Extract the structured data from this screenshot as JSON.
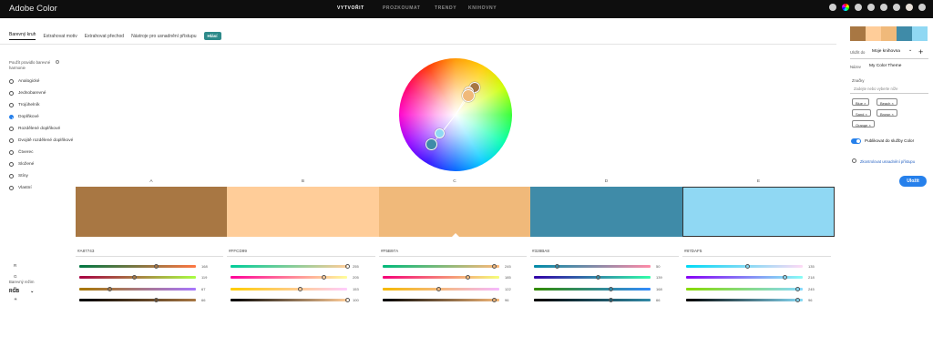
{
  "app_title": "Adobe Color",
  "topnav": [
    "VYTVOŘIT",
    "PROZKOUMAT",
    "TRENDY",
    "KNIHOVNY"
  ],
  "tabs": [
    "Barevný kruh",
    "Extrahovat motiv",
    "Extrahovat přechod",
    "Nástroje pro usnadnění přístupu"
  ],
  "new_badge": "Hlásí",
  "harmony_label": "Použít pravidlo barevné harmonie",
  "rules": [
    "Analogické",
    "Jednobarevné",
    "Trojúhelník",
    "Doplňkové",
    "Rozdělené doplňkové",
    "Dvojitě rozdělené doplňkové",
    "Čtverec",
    "Složené",
    "Stíny",
    "Vlastní"
  ],
  "selected_rule": "Doplňkové",
  "color_mode_label": "Barevný režim",
  "color_mode": "RGB",
  "channels": [
    "R",
    "G",
    "B",
    "☀"
  ],
  "columns": [
    {
      "letter": "A",
      "hex": "#A87743",
      "color": "#a87743",
      "r": "168",
      "g": "119",
      "b": "67",
      "lum": "66",
      "rpos": 0.66,
      "gpos": 0.47,
      "bpos": 0.26,
      "lpos": 0.66,
      "rgrad": "linear-gradient(90deg,#007743,#ff7743)",
      "ggrad": "linear-gradient(90deg,#a80043,#a8ff43)",
      "bgrad": "linear-gradient(90deg,#a87700,#a877ff)",
      "lgrad": "linear-gradient(90deg,#000,#a87743)"
    },
    {
      "letter": "B",
      "hex": "#FFCD99",
      "color": "#ffcd99",
      "r": "255",
      "g": "205",
      "b": "153",
      "lum": "100",
      "rpos": 1,
      "gpos": 0.8,
      "bpos": 0.6,
      "lpos": 1,
      "rgrad": "linear-gradient(90deg,#00cd99,#ffcd99)",
      "ggrad": "linear-gradient(90deg,#ff0099,#ffff99)",
      "bgrad": "linear-gradient(90deg,#ffcd00,#ffcdff)",
      "lgrad": "linear-gradient(90deg,#000,#ffcd99)"
    },
    {
      "letter": "C",
      "hex": "#F5B97A",
      "color": "#f0b97a",
      "r": "245",
      "g": "185",
      "b": "122",
      "lum": "96",
      "rpos": 0.96,
      "gpos": 0.73,
      "bpos": 0.48,
      "lpos": 0.96,
      "rgrad": "linear-gradient(90deg,#00b97a,#ffb97a)",
      "ggrad": "linear-gradient(90deg,#f50078,#f5ff7a)",
      "bgrad": "linear-gradient(90deg,#f5b900,#f5b9ff)",
      "lgrad": "linear-gradient(90deg,#000,#f5b97a)"
    },
    {
      "letter": "D",
      "hex": "#328BA8",
      "color": "#3f8ba8",
      "r": "50",
      "g": "139",
      "b": "168",
      "lum": "66",
      "rpos": 0.2,
      "gpos": 0.55,
      "bpos": 0.66,
      "lpos": 0.66,
      "rgrad": "linear-gradient(90deg,#008ba8,#ff8ba8)",
      "ggrad": "linear-gradient(90deg,#3200a8,#32ffa8)",
      "bgrad": "linear-gradient(90deg,#328b00,#328bff)",
      "lgrad": "linear-gradient(90deg,#000,#328ba8)"
    },
    {
      "letter": "E",
      "hex": "#87DAF5",
      "color": "#90d8f3",
      "r": "135",
      "g": "218",
      "b": "245",
      "lum": "96",
      "rpos": 0.53,
      "gpos": 0.85,
      "bpos": 0.96,
      "lpos": 0.96,
      "rgrad": "linear-gradient(90deg,#00daf5,#ffdaf5)",
      "ggrad": "linear-gradient(90deg,#8700f5,#87fff5)",
      "bgrad": "linear-gradient(90deg,#87da00,#87daff)",
      "lgrad": "linear-gradient(90deg,#000,#87daf5)"
    }
  ],
  "right_panel": {
    "save_to_label": "Uložit do",
    "library": "Moje knihovna",
    "name_label": "Název",
    "name_value": "My Color Theme",
    "tags_label": "Značky",
    "tags_placeholder": "Zadejte nebo vyberte níže",
    "tags": [
      "Blue",
      "Beach",
      "Sand",
      "Brown",
      "Orange"
    ],
    "publish_label": "Publikovat do služby Color",
    "accessibility_link": "Zkontrolovat usnadnění přístupu",
    "save_button": "Uložit"
  }
}
